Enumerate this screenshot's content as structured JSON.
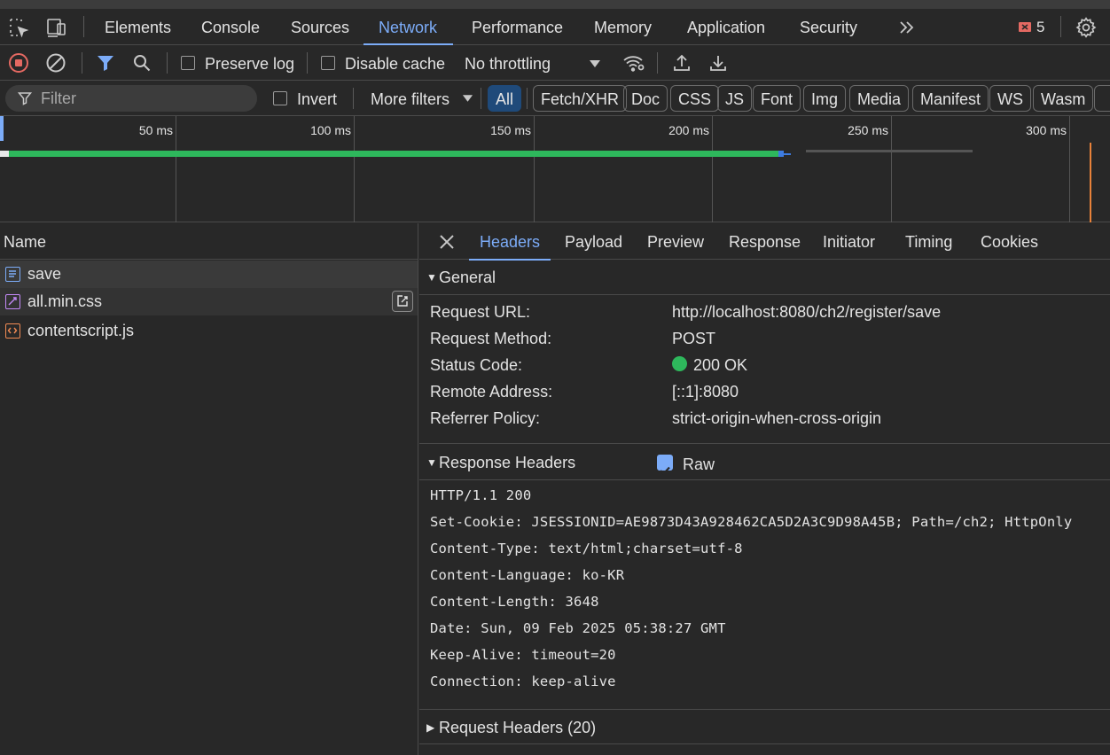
{
  "tabs": [
    "Elements",
    "Console",
    "Sources",
    "Network",
    "Performance",
    "Memory",
    "Application",
    "Security"
  ],
  "error_count": "5",
  "toolbar": {
    "preserve_log": "Preserve log",
    "disable_cache": "Disable cache",
    "throttling": "No throttling"
  },
  "filterbar": {
    "filter_placeholder": "Filter",
    "invert": "Invert",
    "more_filters": "More filters",
    "chips": [
      "All",
      "Fetch/XHR",
      "Doc",
      "CSS",
      "JS",
      "Font",
      "Img",
      "Media",
      "Manifest",
      "WS",
      "Wasm"
    ]
  },
  "timeline": {
    "ticks": [
      "50 ms",
      "100 ms",
      "150 ms",
      "200 ms",
      "250 ms",
      "300 ms"
    ]
  },
  "requests": {
    "header": "Name",
    "items": [
      "save",
      "all.min.css",
      "contentscript.js"
    ]
  },
  "details": {
    "tabs": [
      "Headers",
      "Payload",
      "Preview",
      "Response",
      "Initiator",
      "Timing",
      "Cookies"
    ],
    "general": {
      "title": "General",
      "rows": [
        {
          "k": "Request URL:",
          "v": "http://localhost:8080/ch2/register/save"
        },
        {
          "k": "Request Method:",
          "v": "POST"
        },
        {
          "k": "Status Code:",
          "v": "200 OK"
        },
        {
          "k": "Remote Address:",
          "v": "[::1]:8080"
        },
        {
          "k": "Referrer Policy:",
          "v": "strict-origin-when-cross-origin"
        }
      ]
    },
    "response_headers": {
      "title": "Response Headers",
      "raw_label": "Raw",
      "lines": [
        "HTTP/1.1 200",
        "Set-Cookie: JSESSIONID=AE9873D43A928462CA5D2A3C9D98A45B; Path=/ch2; HttpOnly",
        "Content-Type: text/html;charset=utf-8",
        "Content-Language: ko-KR",
        "Content-Length: 3648",
        "Date: Sun, 09 Feb 2025 05:38:27 GMT",
        "Keep-Alive: timeout=20",
        "Connection: keep-alive"
      ]
    },
    "request_headers": {
      "title": "Request Headers (20)"
    }
  },
  "colors": {
    "accent": "#7cacf8",
    "status_ok": "#2eb85c",
    "record": "#e46962",
    "bar": "#2eb85c"
  },
  "icons": [
    "inspect-icon",
    "device-icon",
    "more-tabs-icon",
    "error-icon",
    "settings-icon",
    "record-icon",
    "clear-icon",
    "filter-icon",
    "search-icon",
    "wifi-settings-icon",
    "upload-icon",
    "download-icon",
    "close-icon"
  ]
}
